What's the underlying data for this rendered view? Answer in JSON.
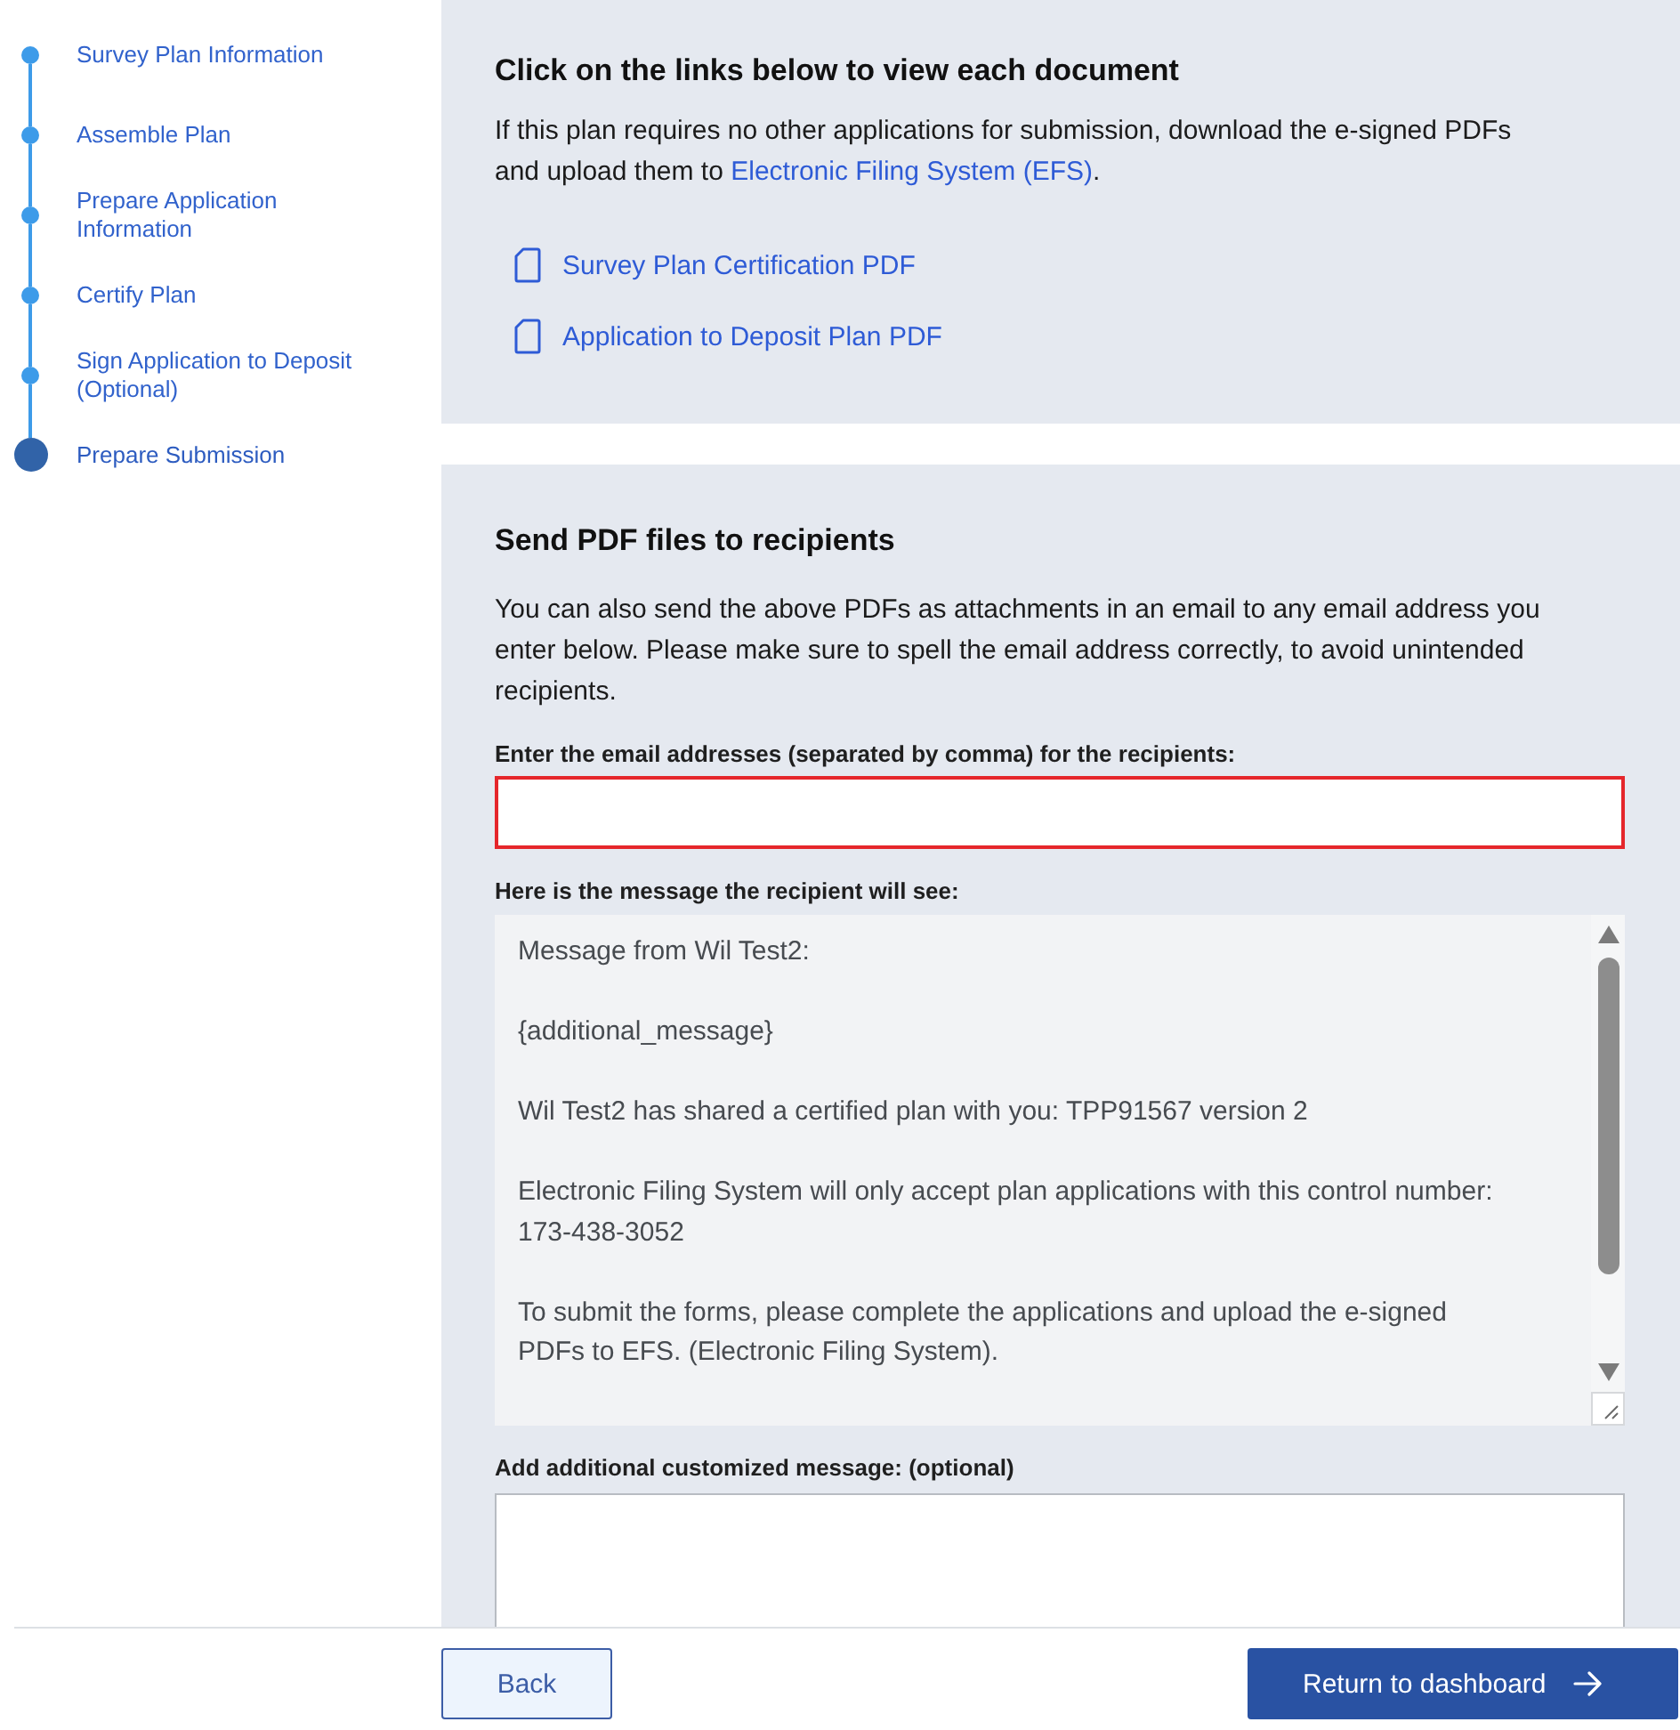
{
  "steps": [
    {
      "label": "Survey Plan Information",
      "selected": false
    },
    {
      "label": "Assemble Plan",
      "selected": false
    },
    {
      "label": "Prepare Application Information",
      "selected": false
    },
    {
      "label": "Certify Plan",
      "selected": false
    },
    {
      "label": "Sign Application to Deposit (Optional)",
      "selected": false
    },
    {
      "label": "Prepare Submission",
      "selected": true
    }
  ],
  "documents_section": {
    "title": "Click on the links below to view each document",
    "text_before": "If this plan requires no other applications for submission, download the e-signed PDFs and upload them to ",
    "link": "Electronic Filing System (EFS)",
    "text_after": ".",
    "documents": [
      {
        "label": "Survey Plan Certification PDF"
      },
      {
        "label": "Application to Deposit Plan PDF"
      }
    ]
  },
  "send_section": {
    "title": "Send PDF files to recipients",
    "description": "You can also send the above PDFs as attachments in an email to any email address you enter below. Please make sure to spell the email address correctly, to avoid unintended recipients.",
    "recipients_field": {
      "label": "Enter the email addresses (separated by comma) for the recipients:",
      "invalid": true
    },
    "message_preview": {
      "label": "Here is the message the recipient will see:",
      "paragraphs": [
        "Message from Wil Test2:",
        "{additional_message}",
        "Wil Test2 has shared a certified plan with you: TPP91567 version 2",
        "Electronic Filing System will only accept plan applications with this control number: 173-438-3052",
        "To submit the forms, please complete the applications and upload the e-signed PDFs to EFS. (Electronic Filing System)."
      ]
    },
    "additional_message_field": {
      "label": "Add additional customized message: (optional)"
    }
  },
  "footer": {
    "back_button": "Back",
    "primary_button": "Return to dashboard"
  }
}
